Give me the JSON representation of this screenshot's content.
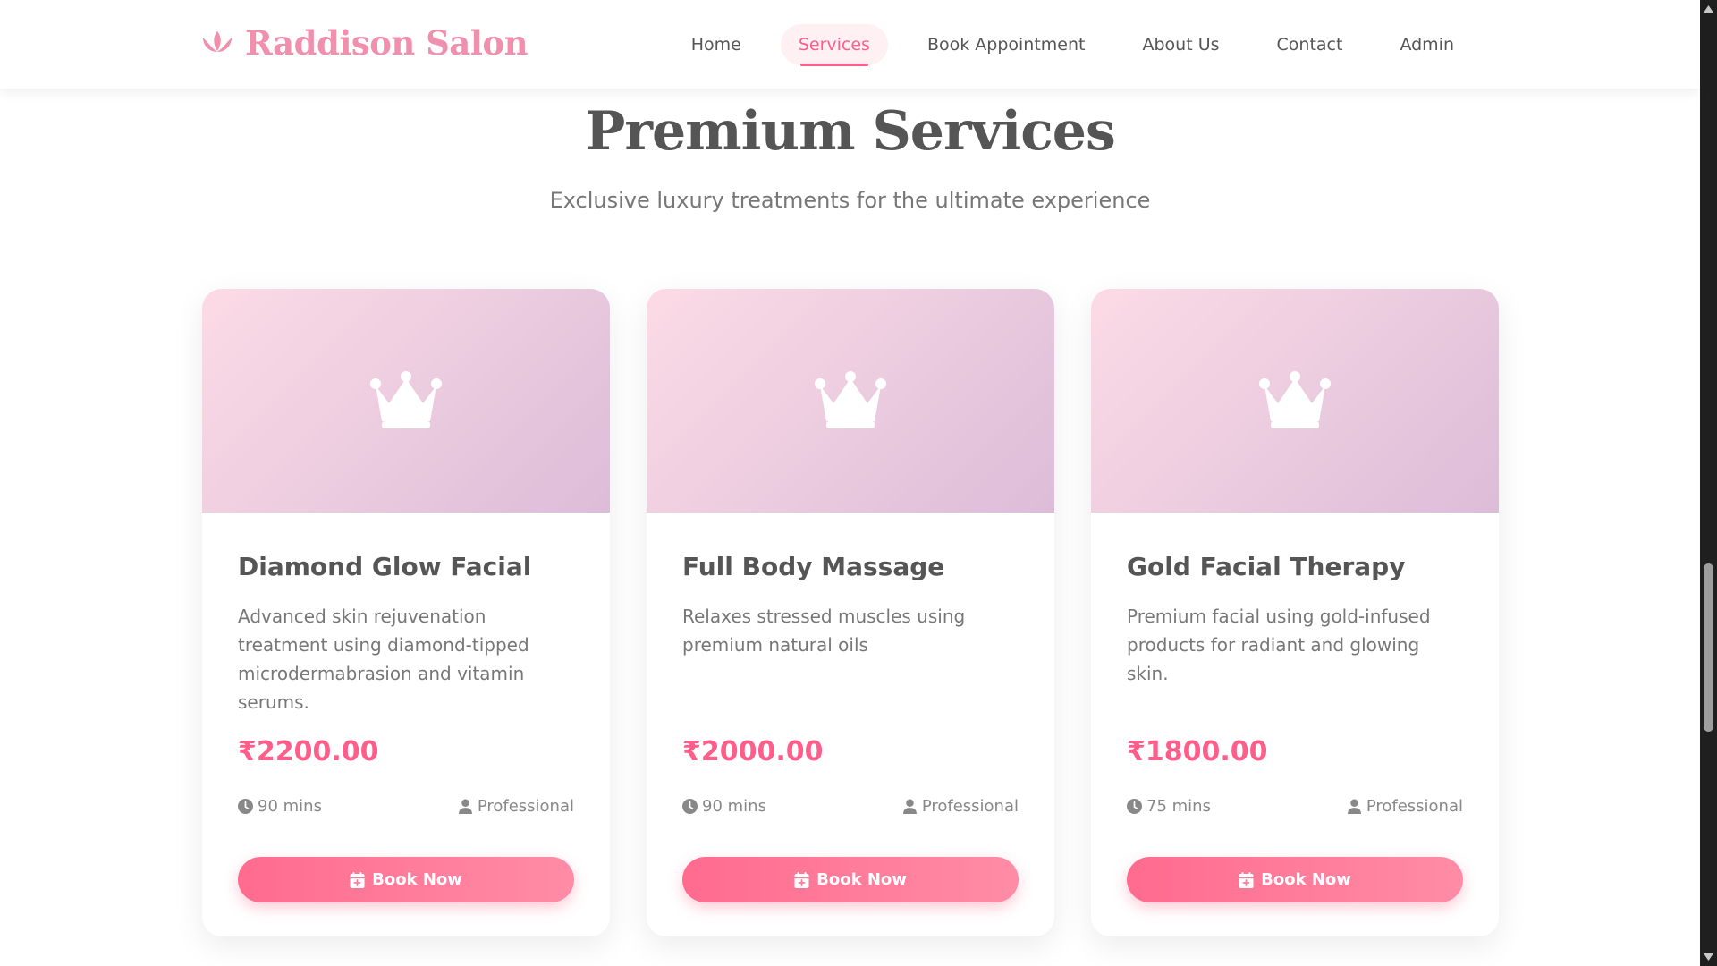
{
  "brand": {
    "name": "Raddison Salon",
    "icon": "lotus-icon",
    "color": "#f08fae"
  },
  "nav": {
    "items": [
      {
        "label": "Home",
        "active": false
      },
      {
        "label": "Services",
        "active": true
      },
      {
        "label": "Book Appointment",
        "active": false
      },
      {
        "label": "About Us",
        "active": false
      },
      {
        "label": "Contact",
        "active": false
      },
      {
        "label": "Admin",
        "active": false
      }
    ]
  },
  "hero": {
    "title": "Premium Services",
    "subtitle": "Exclusive luxury treatments for the ultimate experience"
  },
  "cards": [
    {
      "icon": "crown-icon",
      "title": "Diamond Glow Facial",
      "description": "Advanced skin rejuvenation treatment using diamond-tipped microdermabrasion and vitamin serums.",
      "price": "₹2200.00",
      "duration": "90 mins",
      "staff": "Professional",
      "button_label": "Book Now"
    },
    {
      "icon": "crown-icon",
      "title": "Full Body Massage",
      "description": "Relaxes stressed muscles using premium natural oils",
      "price": "₹2000.00",
      "duration": "90 mins",
      "staff": "Professional",
      "button_label": "Book Now"
    },
    {
      "icon": "crown-icon",
      "title": "Gold Facial Therapy",
      "description": "Premium facial using gold-infused products for radiant and glowing skin.",
      "price": "₹1800.00",
      "duration": "75 mins",
      "staff": "Professional",
      "button_label": "Book Now"
    }
  ],
  "colors": {
    "accent": "#ff5e8a",
    "button_gradient_start": "#ff6b8f",
    "button_gradient_end": "#ff8ca6",
    "card_media_start": "#fcdbe6",
    "card_media_end": "#dcbcd8"
  }
}
